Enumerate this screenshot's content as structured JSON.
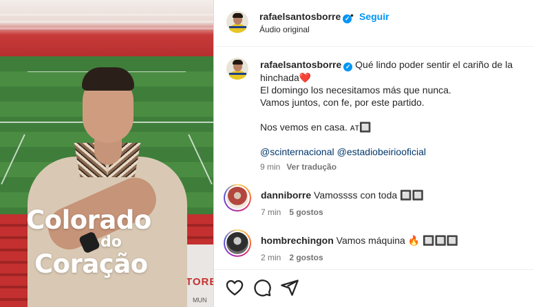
{
  "video": {
    "overlay_line1": "Colorado",
    "overlay_line2": "do",
    "overlay_line3": "Coração",
    "sign_text": "TORE",
    "sign_subtext": "MUN"
  },
  "header": {
    "username": "rafaelsantosborre",
    "verified_mark": "✓",
    "separator": "•",
    "follow_label": "Seguir",
    "audio_label": "Áudio original"
  },
  "caption": {
    "username": "rafaelsantosborre",
    "verified_mark": "✓",
    "line1": "Qué lindo poder sentir el cariño de la hinchada",
    "heart": "❤️",
    "line2": "El domingo los necesitamos más que nunca.",
    "line3": "Vamos juntos, con fe, por este partido.",
    "line4": "Nos vemos en casa. ᴀᴛ🔲",
    "mentions": [
      "@scinternacional",
      "@estadiobeiriooficial"
    ],
    "time": "9 min",
    "translate_label": "Ver tradução"
  },
  "comments": [
    {
      "username": "danniborre",
      "text": "Vamossss con toda 🔲🔲",
      "time": "7 min",
      "likes": "5 gostos"
    },
    {
      "username": "hombrechingon",
      "text": "Vamos máquina 🔥 🔲🔲🔲",
      "time": "2 min",
      "likes": "2 gostos"
    }
  ],
  "actions": {
    "like_icon": "heart-outline-icon",
    "comment_icon": "comment-bubble-icon",
    "share_icon": "paper-plane-icon"
  },
  "colors": {
    "accent": "#0095f6",
    "mention": "#00376b",
    "muted": "#737373",
    "text": "#262626"
  }
}
